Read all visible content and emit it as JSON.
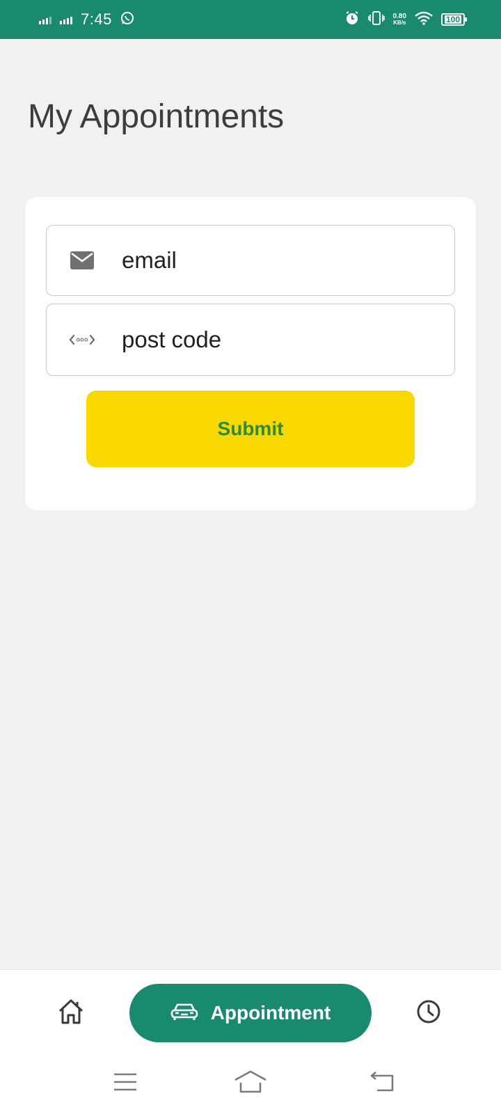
{
  "status_bar": {
    "time": "7:45",
    "net_speed_value": "0.80",
    "net_speed_unit": "KB/s",
    "battery": "100",
    "icons": [
      "signal-icon",
      "signal-icon",
      "whatsapp-icon",
      "alarm-icon",
      "vibrate-icon",
      "wifi-icon",
      "battery-icon"
    ]
  },
  "page": {
    "title": "My Appointments"
  },
  "form": {
    "email_placeholder": "email",
    "email_icon": "mail-icon",
    "postcode_placeholder": "post code",
    "postcode_icon": "code-icon",
    "submit_label": "Submit"
  },
  "bottom_nav": {
    "home_icon": "home-icon",
    "appointment_label": "Appointment",
    "appointment_icon": "car-icon",
    "history_icon": "clock-icon"
  },
  "system_nav": {
    "icons": [
      "menu-icon",
      "home-icon",
      "back-icon"
    ]
  },
  "colors": {
    "primary": "#1a8a6e",
    "accent": "#f9d800",
    "submit_text": "#2e8b3a",
    "background": "#f1f1f1"
  }
}
